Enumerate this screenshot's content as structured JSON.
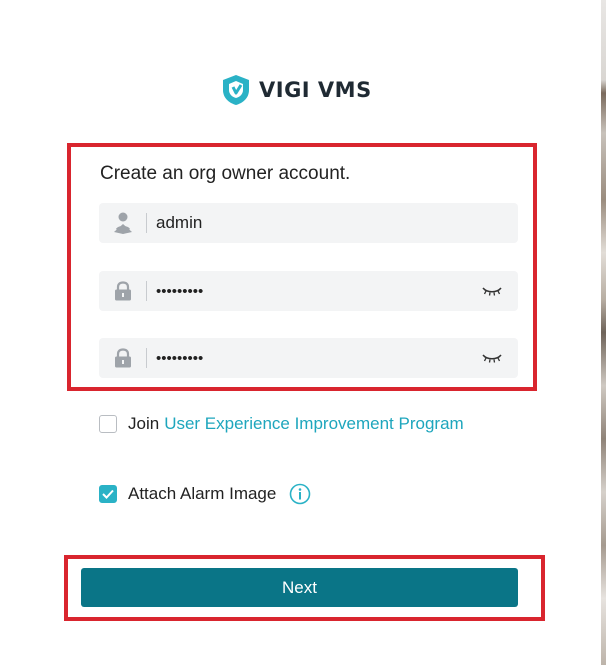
{
  "brand": {
    "name": "VIGI VMS",
    "color": "#2ab2c6"
  },
  "form": {
    "title": "Create an org owner account.",
    "username": {
      "icon": "user-icon",
      "value": "admin"
    },
    "password": {
      "icon": "lock-icon",
      "value": "•••••••••",
      "toggle_icon": "eye-closed-icon"
    },
    "confirm_password": {
      "icon": "lock-icon",
      "value": "•••••••••",
      "toggle_icon": "eye-closed-icon"
    }
  },
  "options": {
    "join_prefix": "Join",
    "join_link": "User Experience Improvement Program",
    "join_checked": false,
    "attach_label": "Attach Alarm Image",
    "attach_checked": true,
    "info_icon": "info-icon"
  },
  "actions": {
    "next_label": "Next",
    "next_color": "#0a7587"
  },
  "annotation_color": "#d9252e"
}
